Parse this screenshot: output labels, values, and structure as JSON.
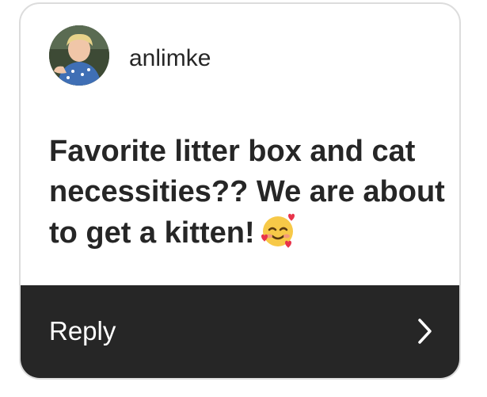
{
  "sticker": {
    "username": "anlimke",
    "avatar_icon": "user-avatar",
    "question": "Favorite litter box and cat necessities?? We are about to get a kitten!",
    "emoji_icon": "smiling-face-with-hearts",
    "reply_label": "Reply",
    "reply_icon": "chevron-right-icon"
  },
  "colors": {
    "reply_bar": "#262626",
    "text": "#262626",
    "border": "#dcdcdc"
  }
}
